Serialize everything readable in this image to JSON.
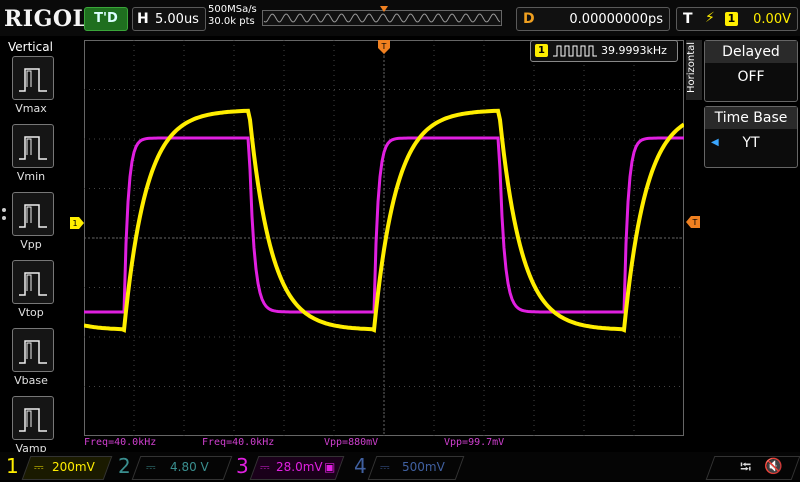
{
  "topbar": {
    "brand": "RIGOL",
    "trigger_status": "T'D",
    "horizontal": {
      "tag": "H",
      "value": "5.00us"
    },
    "sample_rate": "500MSa/s",
    "memory_depth": "30.0k pts",
    "delay": {
      "tag": "D",
      "value": "0.00000000ps"
    },
    "trigger": {
      "tag": "T",
      "channel": "1",
      "level": "0.00V"
    }
  },
  "left_menu": {
    "title": "Vertical",
    "items": [
      {
        "label": "Vmax"
      },
      {
        "label": "Vmin"
      },
      {
        "label": "Vpp"
      },
      {
        "label": "Vtop"
      },
      {
        "label": "Vbase"
      },
      {
        "label": "Vamp"
      }
    ]
  },
  "right_menu": {
    "section_label": "Horizontal",
    "items": [
      {
        "title": "Delayed",
        "value": "OFF"
      },
      {
        "title": "Time Base",
        "value": "YT"
      }
    ]
  },
  "frequency_badge": {
    "channel": "1",
    "value": "39.9993kHz"
  },
  "measurements": [
    {
      "text": "Freq=40.0kHz"
    },
    {
      "text": "Freq=40.0kHz"
    },
    {
      "text": "Vpp=880mV"
    },
    {
      "text": "Vpp=99.7mV"
    }
  ],
  "channels": [
    {
      "num": "1",
      "scale": "200mV",
      "color": "#ffee00",
      "active": true
    },
    {
      "num": "2",
      "scale": "4.80 V",
      "color": "#3a8f8f",
      "active": false
    },
    {
      "num": "3",
      "scale": "28.0mV",
      "color": "#e020e0",
      "active": true
    },
    {
      "num": "4",
      "scale": "500mV",
      "color": "#4060a0",
      "active": false
    }
  ],
  "colors": {
    "ch1": "#ffee00",
    "ch3": "#e020e0",
    "grid": "#555555",
    "trigger": "#f08020"
  },
  "icons": {
    "usb": "usb-icon",
    "sound": "speaker-muted-icon"
  }
}
